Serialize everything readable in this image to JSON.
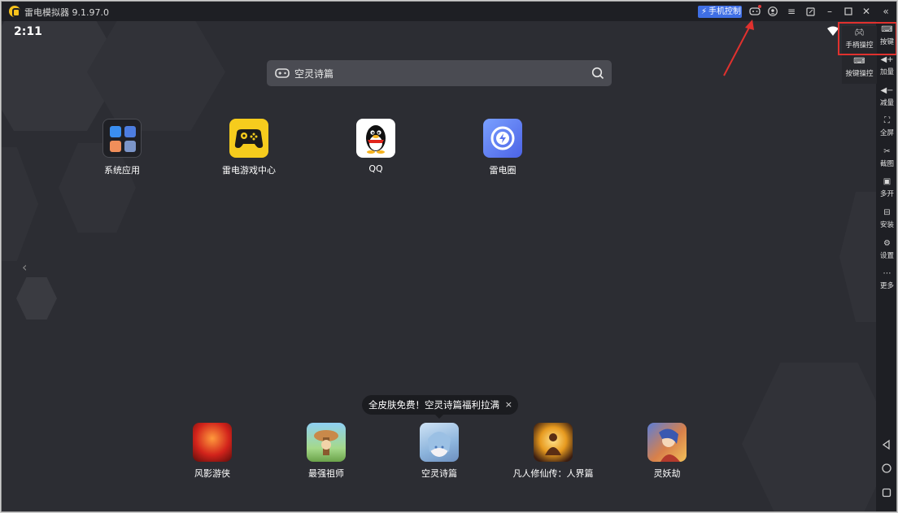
{
  "titlebar": {
    "app_title": "雷电模拟器 9.1.97.0",
    "phone_control_label": "手机控制",
    "icons": [
      "gamepad-icon",
      "user-icon",
      "menu-icon",
      "restore-icon",
      "minimize-icon",
      "maximize-icon",
      "close-icon",
      "collapse-icon"
    ]
  },
  "status": {
    "time": "2:11"
  },
  "search": {
    "text": "空灵诗篇"
  },
  "desktop_apps": [
    {
      "label": "系统应用"
    },
    {
      "label": "雷电游戏中心"
    },
    {
      "label": "QQ"
    },
    {
      "label": "雷电圈"
    }
  ],
  "promo": {
    "text": "全皮肤免费！空灵诗篇福利拉满",
    "close": "×"
  },
  "dock_apps": [
    {
      "label": "风影游侠"
    },
    {
      "label": "最强祖师"
    },
    {
      "label": "空灵诗篇"
    },
    {
      "label": "凡人修仙传：人界篇"
    },
    {
      "label": "灵妖劫"
    }
  ],
  "sidebar": {
    "items": [
      {
        "label": "按键"
      },
      {
        "label": "加量"
      },
      {
        "label": "减量"
      },
      {
        "label": "全屏"
      },
      {
        "label": "截图"
      },
      {
        "label": "多开"
      },
      {
        "label": "安装"
      },
      {
        "label": "设置"
      },
      {
        "label": "更多"
      }
    ]
  },
  "key_panel": {
    "items": [
      {
        "label": "手柄操控"
      },
      {
        "label": "按键操控"
      }
    ]
  },
  "colors": {
    "background": "#2c2d33",
    "titlebar": "#1e1f24",
    "accent": "#3f6fe5",
    "highlight": "#e0312e"
  }
}
